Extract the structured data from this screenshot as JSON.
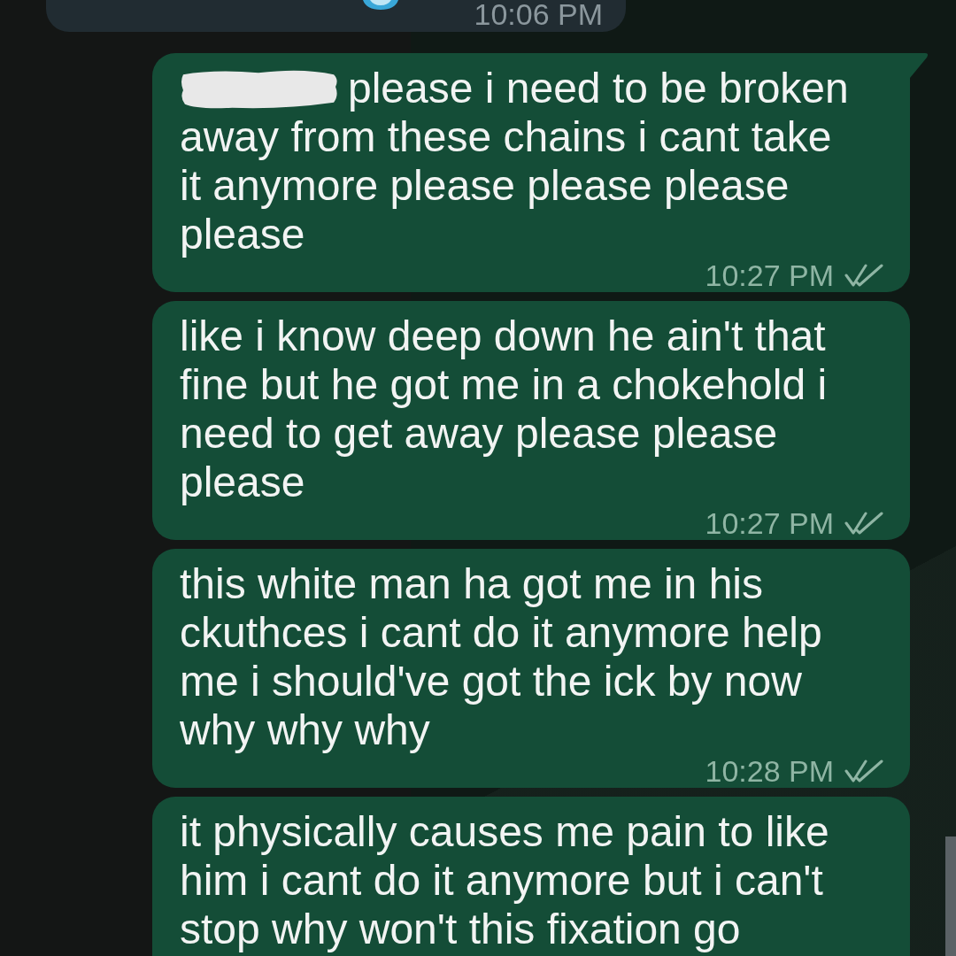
{
  "received_message": {
    "time": "10:06 PM"
  },
  "messages": [
    {
      "text": "please i need to be broken away from these chains i cant take it anymore please please please please",
      "redacted_prefix": true,
      "tail": true,
      "time": "10:27 PM",
      "read": false
    },
    {
      "text": "like i know deep down he ain't that fine but he got me in a chokehold i need to get away please please please",
      "redacted_prefix": false,
      "tail": false,
      "time": "10:27 PM",
      "read": false
    },
    {
      "text": "this white man ha got me in his ckuthces i cant do it anymore help me i should've got the ick by now why why why",
      "redacted_prefix": false,
      "tail": false,
      "time": "10:28 PM",
      "read": false
    },
    {
      "text": "it physically causes me pain to like him i cant do it anymore but i can't stop why won't this fixation go",
      "redacted_prefix": false,
      "tail": false
    }
  ]
}
